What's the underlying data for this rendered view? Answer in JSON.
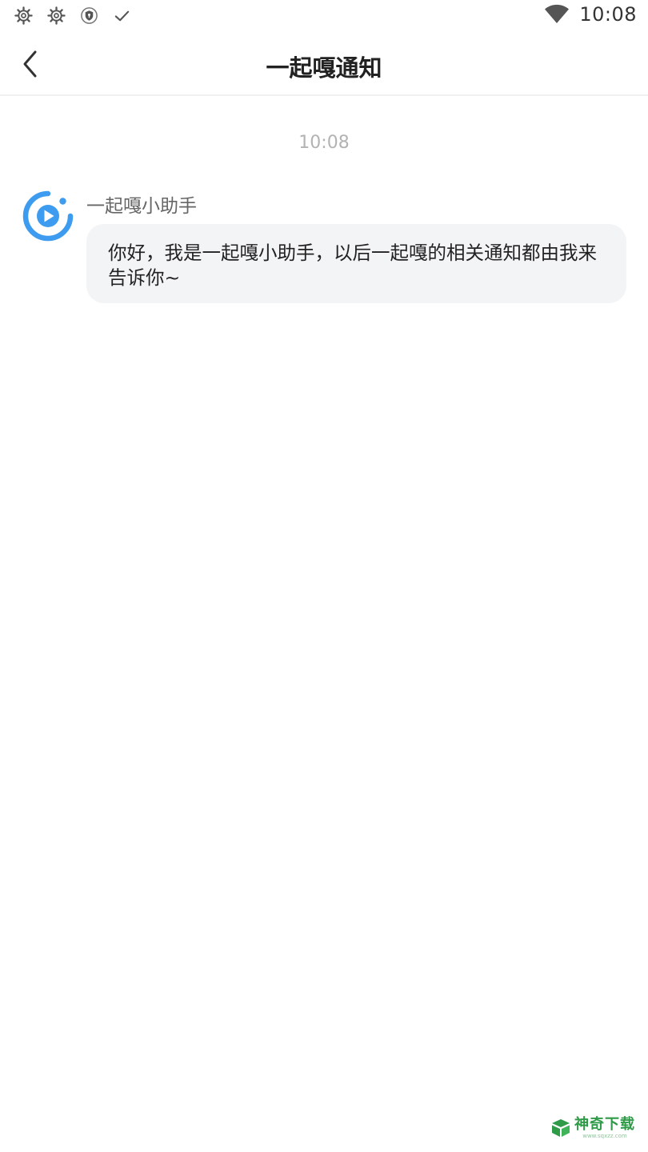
{
  "status_bar": {
    "time": "10:08",
    "left_icons": [
      "gear-icon",
      "gear-icon",
      "shield-icon",
      "check-icon"
    ],
    "right_icons": [
      "wifi-icon"
    ]
  },
  "header": {
    "title": "一起嘎通知",
    "back_icon": "chevron-left-icon"
  },
  "chat": {
    "timestamp": "10:08",
    "messages": [
      {
        "sender": "一起嘎小助手",
        "avatar_icon": "play-circle-icon",
        "text": "你好，我是一起嘎小助手，以后一起嘎的相关通知都由我来告诉你~"
      }
    ]
  },
  "watermark": {
    "text": "神奇下载",
    "sub": "www.sqxzz.com"
  },
  "colors": {
    "accent_blue": "#3d9cf0",
    "bubble_bg": "#f3f4f6",
    "watermark_green": "#2f9a47"
  }
}
